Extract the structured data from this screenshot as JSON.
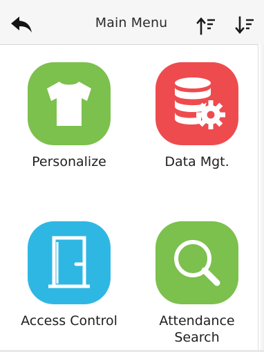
{
  "header": {
    "title": "Main Menu",
    "back_icon": "back-arrow-icon",
    "sort_up_icon": "sort-ascending-icon",
    "sort_down_icon": "sort-descending-icon"
  },
  "menu": {
    "items": [
      {
        "label": "Personalize",
        "icon": "tshirt-icon",
        "color": "#7cc04d"
      },
      {
        "label": "Data Mgt.",
        "icon": "database-gear-icon",
        "color": "#ee4b4f"
      },
      {
        "label": "Access Control",
        "icon": "door-icon",
        "color": "#2fb7e3"
      },
      {
        "label_line1": "Attendance",
        "label_line2": "Search",
        "icon": "magnifier-icon",
        "color": "#7cc04d"
      }
    ]
  }
}
